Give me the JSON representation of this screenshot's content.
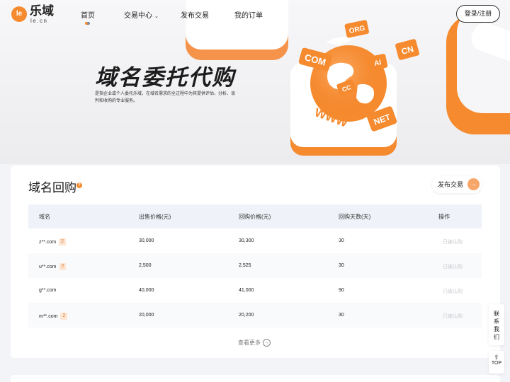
{
  "nav": {
    "logo_text": "乐域",
    "logo_sub": "le.cn",
    "logo_mark": "le",
    "items": [
      {
        "label": "首页"
      },
      {
        "label": "交易中心",
        "has_dropdown": true
      },
      {
        "label": "发布交易"
      },
      {
        "label": "我的订单"
      }
    ],
    "login_label": "登录/注册"
  },
  "hero": {
    "title": "域名委托代购",
    "description": "是指企业或个人委托乐域，在域名需求的全过程中为其提供评估、分析、谈判和收购的专业服务。",
    "art_labels": [
      "COM",
      "ORG",
      "AI",
      "CN",
      "CC",
      "NET",
      "WWW"
    ],
    "slides": 5,
    "active_slide": 0
  },
  "panel": {
    "title": "域名回购",
    "help_icon": "?",
    "publish_label": "发布交易",
    "table": {
      "headers": [
        "域名",
        "出售价格(元)",
        "回购价格(元)",
        "回购天数(天)",
        "操作"
      ],
      "rows": [
        {
          "domain": "z**.com",
          "badge": "2",
          "sell": "30,000",
          "buyback": "30,300",
          "days": "30",
          "action": "已被认购"
        },
        {
          "domain": "u**.com",
          "badge": "2",
          "sell": "2,500",
          "buyback": "2,525",
          "days": "30",
          "action": "已被认购"
        },
        {
          "domain": "g**.com",
          "badge": "",
          "sell": "40,000",
          "buyback": "41,000",
          "days": "90",
          "action": "已被认购"
        },
        {
          "domain": "m**.com",
          "badge": "2",
          "sell": "20,000",
          "buyback": "20,200",
          "days": "30",
          "action": "已被认购"
        }
      ]
    },
    "more_label": "查看更多"
  },
  "side": {
    "contact_chars": [
      "联",
      "系",
      "我",
      "们"
    ],
    "top_label": "TOP"
  },
  "colors": {
    "accent": "#f58a2e",
    "badge_bg": "#fde5d3",
    "table_head_bg": "#eff3f9"
  }
}
